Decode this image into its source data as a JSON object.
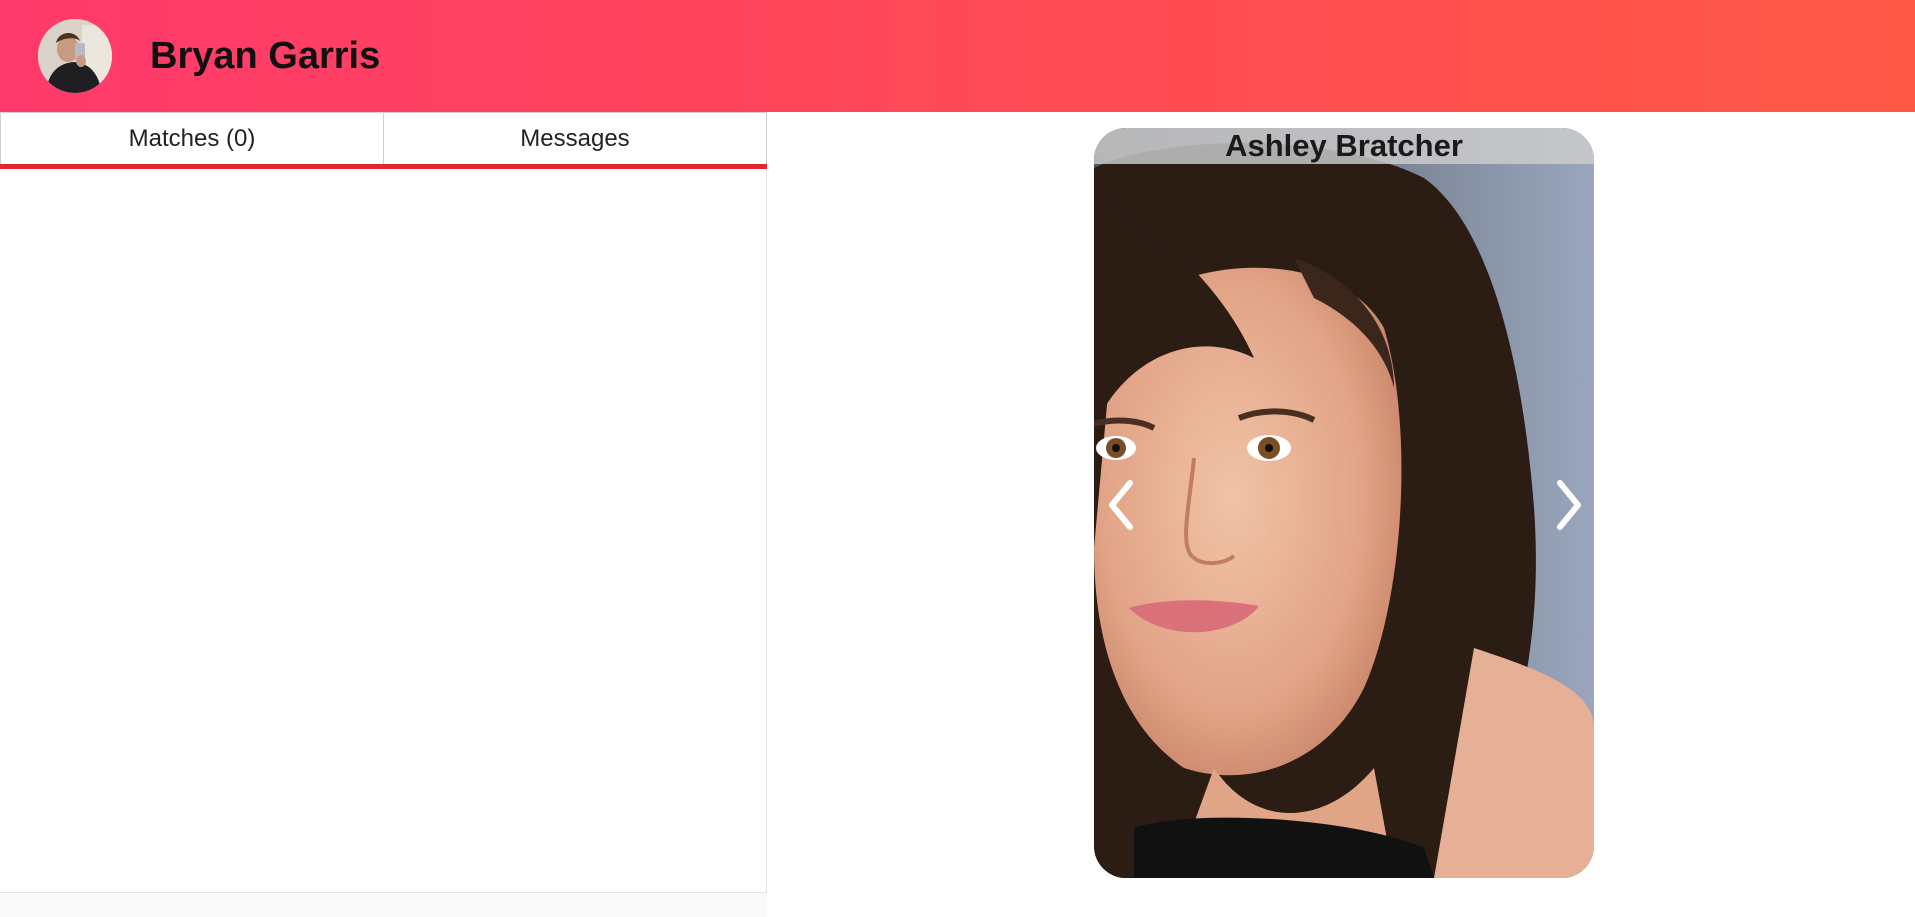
{
  "header": {
    "user_name": "Bryan Garris",
    "avatar_icon": "user-avatar-photo",
    "gradient": [
      "#ff3a6c",
      "#ff5847"
    ]
  },
  "sidebar": {
    "tabs": [
      {
        "label": "Matches (0)",
        "active": true
      },
      {
        "label": "Messages",
        "active": false
      }
    ],
    "accent": "#e0262f"
  },
  "card": {
    "name": "Ashley Bratcher",
    "prev_icon": "chevron-left-icon",
    "next_icon": "chevron-right-icon"
  }
}
